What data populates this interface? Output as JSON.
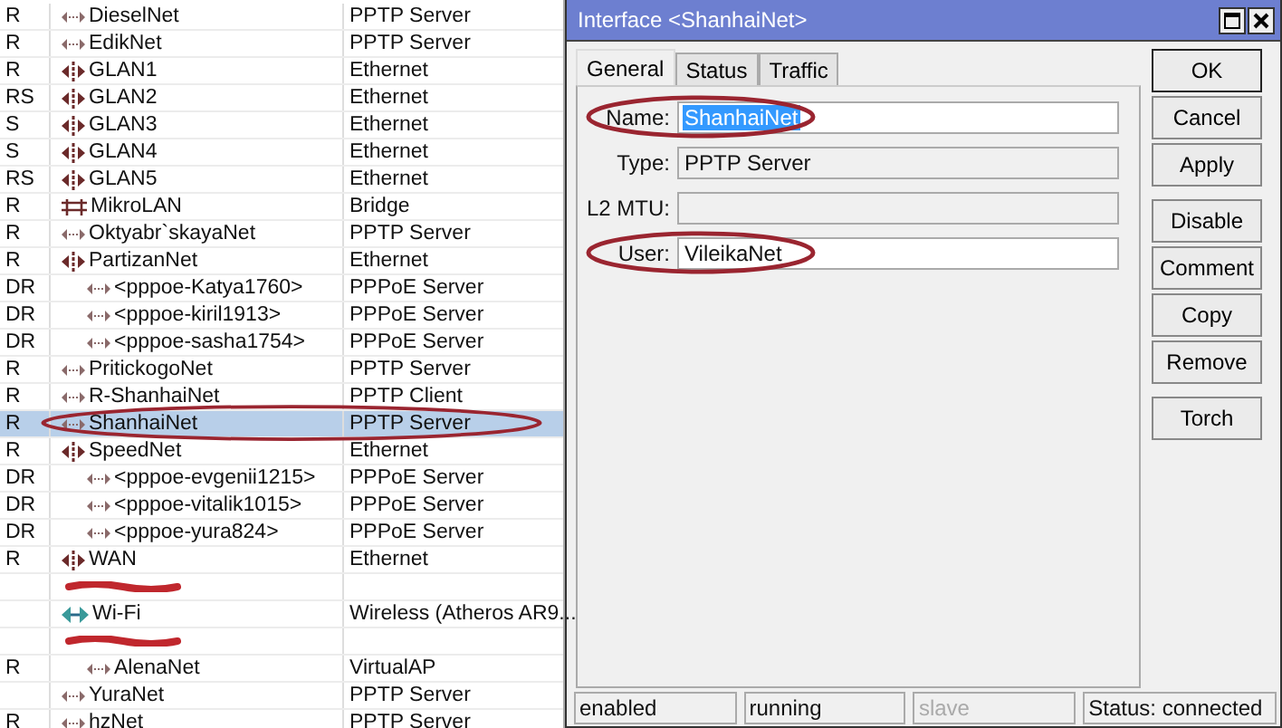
{
  "interfaces": [
    {
      "kind": "pptp",
      "flags": "R",
      "name": "DieselNet",
      "type": "PPTP Server",
      "selected": false
    },
    {
      "kind": "pptp",
      "flags": "R",
      "name": "EdikNet",
      "type": "PPTP Server",
      "selected": false
    },
    {
      "kind": "ethernet",
      "flags": "R",
      "name": "GLAN1",
      "type": "Ethernet",
      "selected": false
    },
    {
      "kind": "ethernet",
      "flags": "RS",
      "name": "GLAN2",
      "type": "Ethernet",
      "selected": false
    },
    {
      "kind": "ethernet",
      "flags": "S",
      "name": "GLAN3",
      "type": "Ethernet",
      "selected": false
    },
    {
      "kind": "ethernet",
      "flags": "S",
      "name": "GLAN4",
      "type": "Ethernet",
      "selected": false
    },
    {
      "kind": "ethernet",
      "flags": "RS",
      "name": "GLAN5",
      "type": "Ethernet",
      "selected": false
    },
    {
      "kind": "bridge",
      "flags": "R",
      "name": "MikroLAN",
      "type": "Bridge",
      "selected": false
    },
    {
      "kind": "pptp",
      "flags": "R",
      "name": "Oktyabr`skayaNet",
      "type": "PPTP Server",
      "selected": false
    },
    {
      "kind": "ethernet",
      "flags": "R",
      "name": "PartizanNet",
      "type": "Ethernet",
      "selected": false,
      "children": [
        {
          "kind": "pptp",
          "flags": "DR",
          "name": "<pppoe-Katya1760>",
          "type": "PPPoE Server",
          "selected": false
        },
        {
          "kind": "pptp",
          "flags": "DR",
          "name": "<pppoe-kiril1913>",
          "type": "PPPoE Server",
          "selected": false
        },
        {
          "kind": "pptp",
          "flags": "DR",
          "name": "<pppoe-sasha1754>",
          "type": "PPPoE Server",
          "selected": false
        }
      ]
    },
    {
      "kind": "pptp",
      "flags": "R",
      "name": "PritickogoNet",
      "type": "PPTP Server",
      "selected": false
    },
    {
      "kind": "pptp",
      "flags": "R",
      "name": "R-ShanhaiNet",
      "type": "PPTP Client",
      "selected": false
    },
    {
      "kind": "pptp",
      "flags": "R",
      "name": "ShanhaiNet",
      "type": "PPTP Server",
      "selected": true,
      "circled": true
    },
    {
      "kind": "ethernet",
      "flags": "R",
      "name": "SpeedNet",
      "type": "Ethernet",
      "selected": false,
      "children": [
        {
          "kind": "pptp",
          "flags": "DR",
          "name": "<pppoe-evgenii1215>",
          "type": "PPPoE Server",
          "selected": false
        },
        {
          "kind": "pptp",
          "flags": "DR",
          "name": "<pppoe-vitalik1015>",
          "type": "PPPoE Server",
          "selected": false
        },
        {
          "kind": "pptp",
          "flags": "DR",
          "name": "<pppoe-yura824>",
          "type": "PPPoE Server",
          "selected": false
        }
      ]
    },
    {
      "kind": "ethernet",
      "flags": "R",
      "name": "WAN",
      "type": "Ethernet",
      "selected": false
    },
    {
      "kind": "redacted"
    },
    {
      "kind": "wireless",
      "name": "Wi-Fi",
      "type": "Wireless (Atheros AR9...",
      "selected": false
    },
    {
      "kind": "redacted",
      "children": [
        {
          "kind": "pptp",
          "flags": "R",
          "name": "AlenaNet",
          "type": "VirtualAP",
          "selected": false
        }
      ]
    },
    {
      "kind": "pptp",
      "name": "YuraNet",
      "type": "PPTP Server",
      "selected": false
    },
    {
      "kind": "pptp",
      "flags": "R",
      "name": "hzNet",
      "type": "PPTP Server",
      "selected": false
    }
  ],
  "dialog": {
    "title": "Interface <ShanhaiNet>",
    "tabs": [
      {
        "label": "General",
        "selected": true
      },
      {
        "label": "Status",
        "selected": false
      },
      {
        "label": "Traffic",
        "selected": false
      }
    ],
    "fields": [
      {
        "label": "Name:",
        "value": "ShanhaiNet",
        "highlighted": true,
        "circled": true,
        "disabled": false
      },
      {
        "label": "Type:",
        "value": "PPTP Server",
        "disabled": true
      },
      {
        "label": "L2 MTU:",
        "disabled": true
      },
      {
        "label": "User:",
        "value": "VileikaNet",
        "circled": true,
        "disabled": false
      }
    ],
    "button_groups": [
      {
        "buttons": [
          {
            "label": "OK",
            "default": true
          },
          {
            "label": "Cancel",
            "default": false
          },
          {
            "label": "Apply",
            "default": false
          }
        ]
      },
      {
        "buttons": [
          {
            "label": "Disable",
            "default": false
          },
          {
            "label": "Comment",
            "default": false
          },
          {
            "label": "Copy",
            "default": false
          },
          {
            "label": "Remove",
            "default": false
          }
        ]
      },
      {
        "buttons": [
          {
            "label": "Torch",
            "default": false
          }
        ]
      }
    ],
    "status_bar": [
      {
        "text": "enabled",
        "disabled": false
      },
      {
        "text": "running",
        "disabled": false
      },
      {
        "text": "slave",
        "disabled": true
      },
      {
        "text": "Status: connected",
        "disabled": false
      }
    ]
  }
}
